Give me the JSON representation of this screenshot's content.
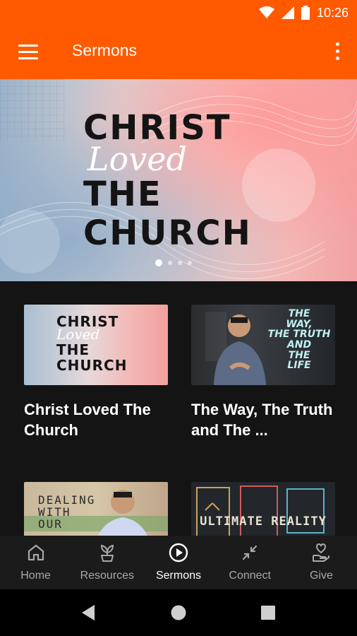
{
  "status_bar": {
    "time": "10:26"
  },
  "app_bar": {
    "title": "Sermons"
  },
  "hero": {
    "lines": [
      "CHRIST",
      "Loved",
      "THE",
      "CHURCH"
    ],
    "slide_count": 4,
    "active_slide": 1
  },
  "cards": [
    {
      "title": "Christ Loved The Church",
      "thumb_lines": [
        "CHRIST",
        "Loved",
        "THE",
        "CHURCH"
      ]
    },
    {
      "title": "The Way, The Truth and The ...",
      "thumb_lines": [
        "THE",
        "WAY,",
        "THE TRUTH",
        "AND",
        "THE",
        "LIFE"
      ]
    },
    {
      "title": "",
      "thumb_lines": [
        "DEALING",
        "WITH",
        "OUR"
      ]
    },
    {
      "title": "",
      "thumb_lines": [
        "ULTIMATE REALITY"
      ]
    }
  ],
  "bottom_nav": [
    {
      "label": "Home",
      "icon": "home-icon",
      "active": false
    },
    {
      "label": "Resources",
      "icon": "sprout-icon",
      "active": false
    },
    {
      "label": "Sermons",
      "icon": "play-circle-icon",
      "active": true
    },
    {
      "label": "Connect",
      "icon": "compress-icon",
      "active": false
    },
    {
      "label": "Give",
      "icon": "heart-hand-icon",
      "active": false
    }
  ],
  "colors": {
    "accent": "#FF5A00",
    "background": "#141414",
    "nav_bg": "#1b1b1b"
  }
}
